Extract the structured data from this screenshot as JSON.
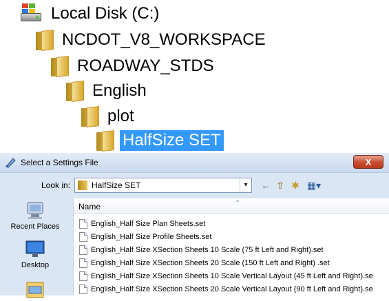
{
  "tree": {
    "items": [
      {
        "label": "Local Disk (C:)",
        "icon": "local-disk-icon"
      },
      {
        "label": "NCDOT_V8_WORKSPACE",
        "icon": "folder-icon"
      },
      {
        "label": "ROADWAY_STDS",
        "icon": "folder-icon"
      },
      {
        "label": "English",
        "icon": "folder-icon"
      },
      {
        "label": "plot",
        "icon": "folder-icon"
      },
      {
        "label": "HalfSize SET",
        "icon": "folder-icon",
        "selected": true
      }
    ],
    "selection_color": "#3399ff"
  },
  "dialog": {
    "title": "Select a Settings File",
    "close_glyph": "X",
    "look_in": {
      "label": "Look in:",
      "value": "HalfSize SET",
      "dropdown_glyph": "▾"
    },
    "nav": {
      "back_glyph": "←",
      "up_glyph": "⇧",
      "new_folder_glyph": "✱",
      "views_glyph": "▦▾"
    },
    "places": [
      {
        "label": "Recent Places",
        "icon": "recent-places-icon"
      },
      {
        "label": "Desktop",
        "icon": "desktop-icon"
      },
      {
        "label": "",
        "icon": "libraries-icon"
      }
    ],
    "column_header": "Name",
    "sort_glyph": "^",
    "files": [
      "English_Half Size Plan Sheets.set",
      "English_Half Size Profile Sheets.set",
      "English_Half Size XSection Sheets  10 Scale (75 ft Left and Right).set",
      "English_Half Size XSection Sheets  20 Scale (150 ft Left and Right) .set",
      "English_Half Size XSection Sheets 10 Scale Vertical Layout (45 ft Left and Right).se",
      "English_Half Size XSection Sheets 20 Scale Vertical Layout (90 ft Left and Right).se"
    ],
    "colors": {
      "close": "#c74b2f",
      "frame": "#dbe6f4"
    }
  }
}
